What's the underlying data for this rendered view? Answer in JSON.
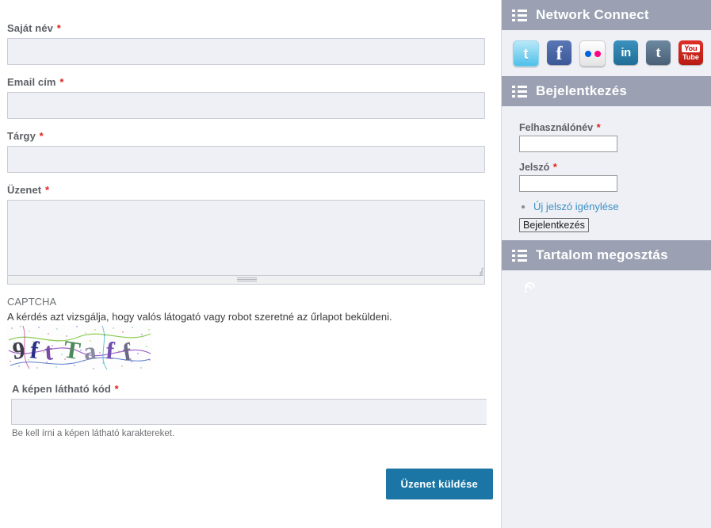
{
  "contact_form": {
    "fields": [
      {
        "label": "Saját név",
        "required": "*",
        "value": "",
        "placeholder": ""
      },
      {
        "label": "Email cím",
        "required": "*",
        "value": "",
        "placeholder": ""
      },
      {
        "label": "Tárgy",
        "required": "*",
        "value": "",
        "placeholder": ""
      }
    ],
    "message": {
      "label": "Üzenet",
      "required": "*",
      "value": "",
      "placeholder": ""
    },
    "captcha": {
      "title": "CAPTCHA",
      "description": "A kérdés azt vizsgálja, hogy valós látogató vagy robot szeretné az űrlapot beküldeni.",
      "image_text": "9ftTaf",
      "code_label": "A képen látható kód",
      "code_required": "*",
      "code_value": "",
      "help_text": "Be kell írni a képen látható karaktereket."
    },
    "submit_label": "Üzenet küldése",
    "submit_color": "#1b76a5"
  },
  "sidebar": {
    "blocks": [
      {
        "title": "Network Connect",
        "social": [
          {
            "name": "twitter",
            "glyph": "t"
          },
          {
            "name": "facebook",
            "glyph": "f"
          },
          {
            "name": "flickr",
            "glyph": ""
          },
          {
            "name": "linkedin",
            "glyph": "in"
          },
          {
            "name": "tumblr",
            "glyph": "t"
          },
          {
            "name": "youtube",
            "glyph_top": "You",
            "glyph_bottom": "Tube"
          }
        ]
      },
      {
        "title": "Bejelentkezés",
        "username_label": "Felhasználónév",
        "username_required": "*",
        "username_value": "",
        "password_label": "Jelszó",
        "password_required": "*",
        "password_value": "",
        "reset_link": "Új jelszó igénylése",
        "login_button": "Bejelentkezés"
      },
      {
        "title": "Tartalom megosztás",
        "feed_icon": "rss-icon"
      }
    ],
    "header_color": "#9ba1b2",
    "background_color": "#eef0f5"
  }
}
